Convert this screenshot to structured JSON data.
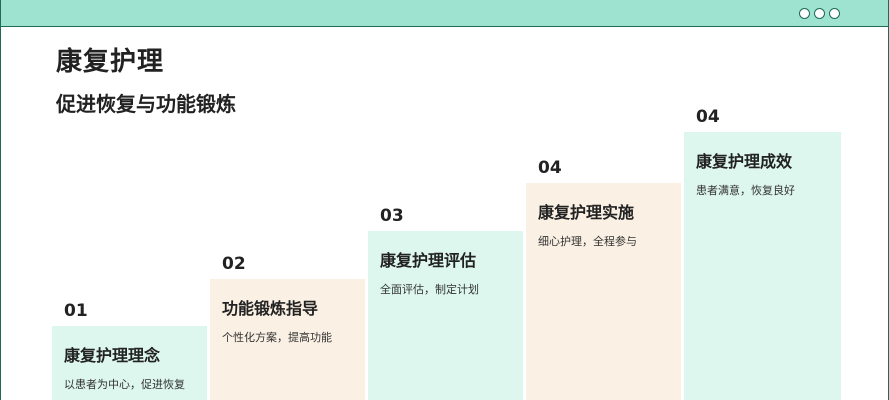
{
  "window": {
    "controls": [
      "window-dot",
      "window-dot",
      "window-dot"
    ],
    "colors": {
      "topbar": "#9ee3cf",
      "border": "#1f6b57",
      "mint": "#ddf6ee",
      "cream": "#faf0e4"
    }
  },
  "header": {
    "title": "康复护理",
    "subtitle": "促进恢复与功能锻炼"
  },
  "steps": [
    {
      "number": "01",
      "title": "康复护理理念",
      "description": "以患者为中心，促进恢复"
    },
    {
      "number": "02",
      "title": "功能锻炼指导",
      "description": "个性化方案，提高功能"
    },
    {
      "number": "03",
      "title": "康复护理评估",
      "description": "全面评估，制定计划"
    },
    {
      "number": "04",
      "title": "康复护理实施",
      "description": "细心护理，全程参与"
    },
    {
      "number": "04",
      "title": "康复护理成效",
      "description": "患者满意，恢复良好"
    }
  ]
}
